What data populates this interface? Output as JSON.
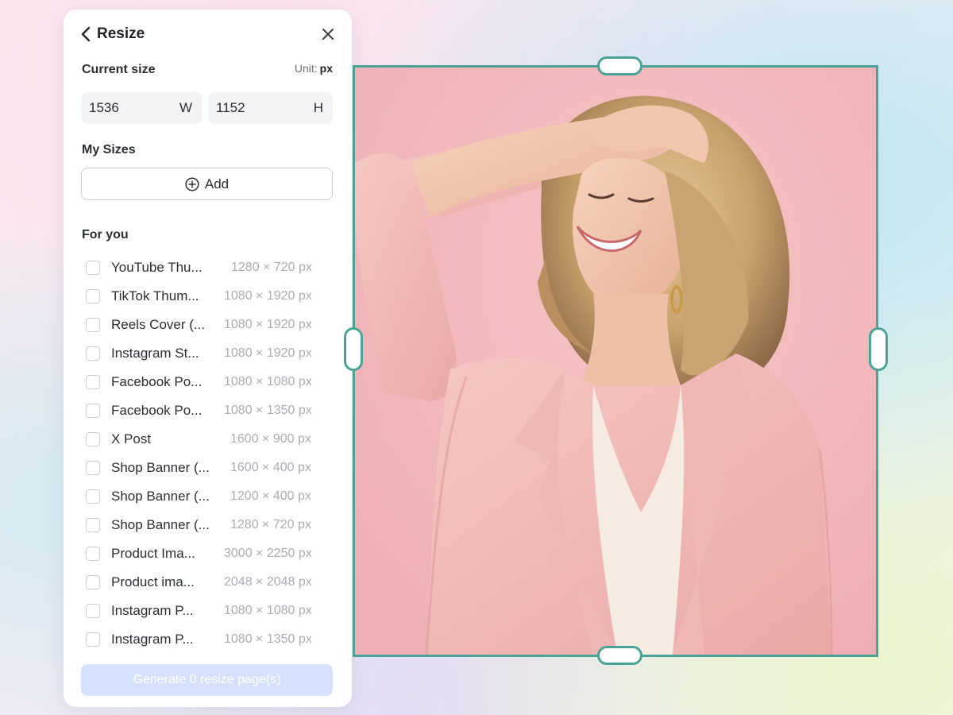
{
  "panel": {
    "title": "Resize",
    "current_size_label": "Current size",
    "unit_label": "Unit:",
    "unit_value": "px",
    "width": "1536",
    "width_axis": "W",
    "height": "1152",
    "height_axis": "H",
    "my_sizes_label": "My Sizes",
    "add_label": "Add",
    "for_you_label": "For you",
    "presets": [
      {
        "name": "YouTube Thu...",
        "size": "1280 × 720 px"
      },
      {
        "name": "TikTok Thum...",
        "size": "1080 × 1920 px"
      },
      {
        "name": "Reels Cover (...",
        "size": "1080 × 1920 px"
      },
      {
        "name": "Instagram St...",
        "size": "1080 × 1920 px"
      },
      {
        "name": "Facebook Po...",
        "size": "1080 × 1080 px"
      },
      {
        "name": "Facebook Po...",
        "size": "1080 × 1350 px"
      },
      {
        "name": "X Post",
        "size": "1600 × 900 px"
      },
      {
        "name": "Shop Banner (...",
        "size": "1600 × 400 px"
      },
      {
        "name": "Shop Banner (...",
        "size": "1200 × 400 px"
      },
      {
        "name": "Shop Banner (...",
        "size": "1280 × 720 px"
      },
      {
        "name": "Product Ima...",
        "size": "3000 × 2250 px"
      },
      {
        "name": "Product ima...",
        "size": "2048 × 2048 px"
      },
      {
        "name": "Instagram P...",
        "size": "1080 × 1080 px"
      },
      {
        "name": "Instagram P...",
        "size": "1080 × 1350 px"
      }
    ],
    "generate_label": "Generate 0 resize page(s)"
  },
  "colors": {
    "frame_accent": "#4aa396",
    "generate_disabled": "#d6e2fd",
    "photo_background": "#f2b9bd"
  },
  "icons": {
    "back": "chevron-left-icon",
    "close": "close-icon",
    "add": "plus-circle-icon"
  }
}
